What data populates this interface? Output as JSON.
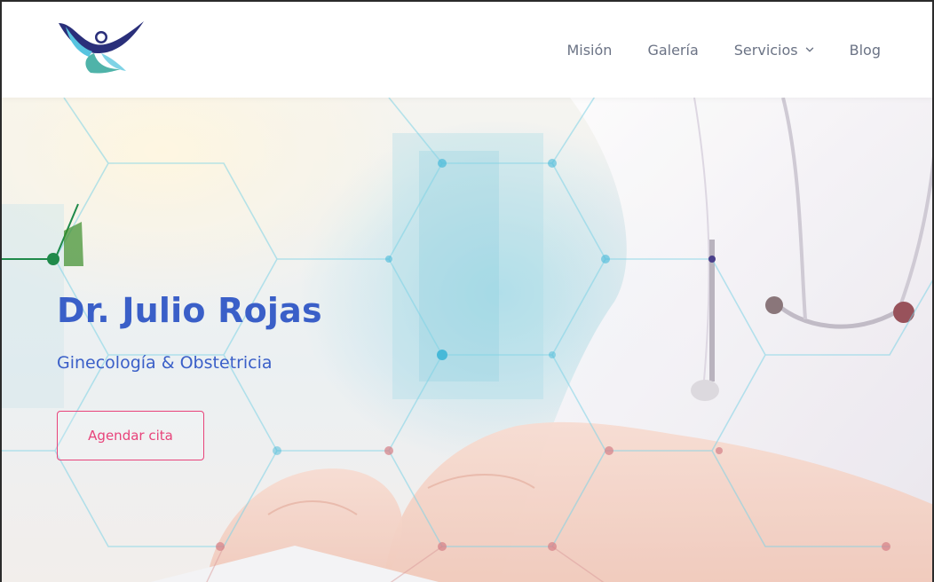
{
  "header": {
    "nav": [
      {
        "label": "Misión",
        "has_dropdown": false
      },
      {
        "label": "Galería",
        "has_dropdown": false
      },
      {
        "label": "Servicios",
        "has_dropdown": true
      },
      {
        "label": "Blog",
        "has_dropdown": false
      }
    ]
  },
  "hero": {
    "title": "Dr. Julio Rojas",
    "subtitle": "Ginecología & Obstetricia",
    "cta_label": "Agendar cita"
  },
  "icons": {
    "logo": "figure-with-arms-raised-logo",
    "dropdown": "chevron-down-icon"
  },
  "colors": {
    "brand_blue": "#3a5fc8",
    "accent_pink": "#e8437a",
    "nav_text": "#6b7385",
    "logo_navy": "#2a2f7a",
    "logo_cyan": "#58c4e0",
    "logo_teal": "#4fb3a9"
  }
}
